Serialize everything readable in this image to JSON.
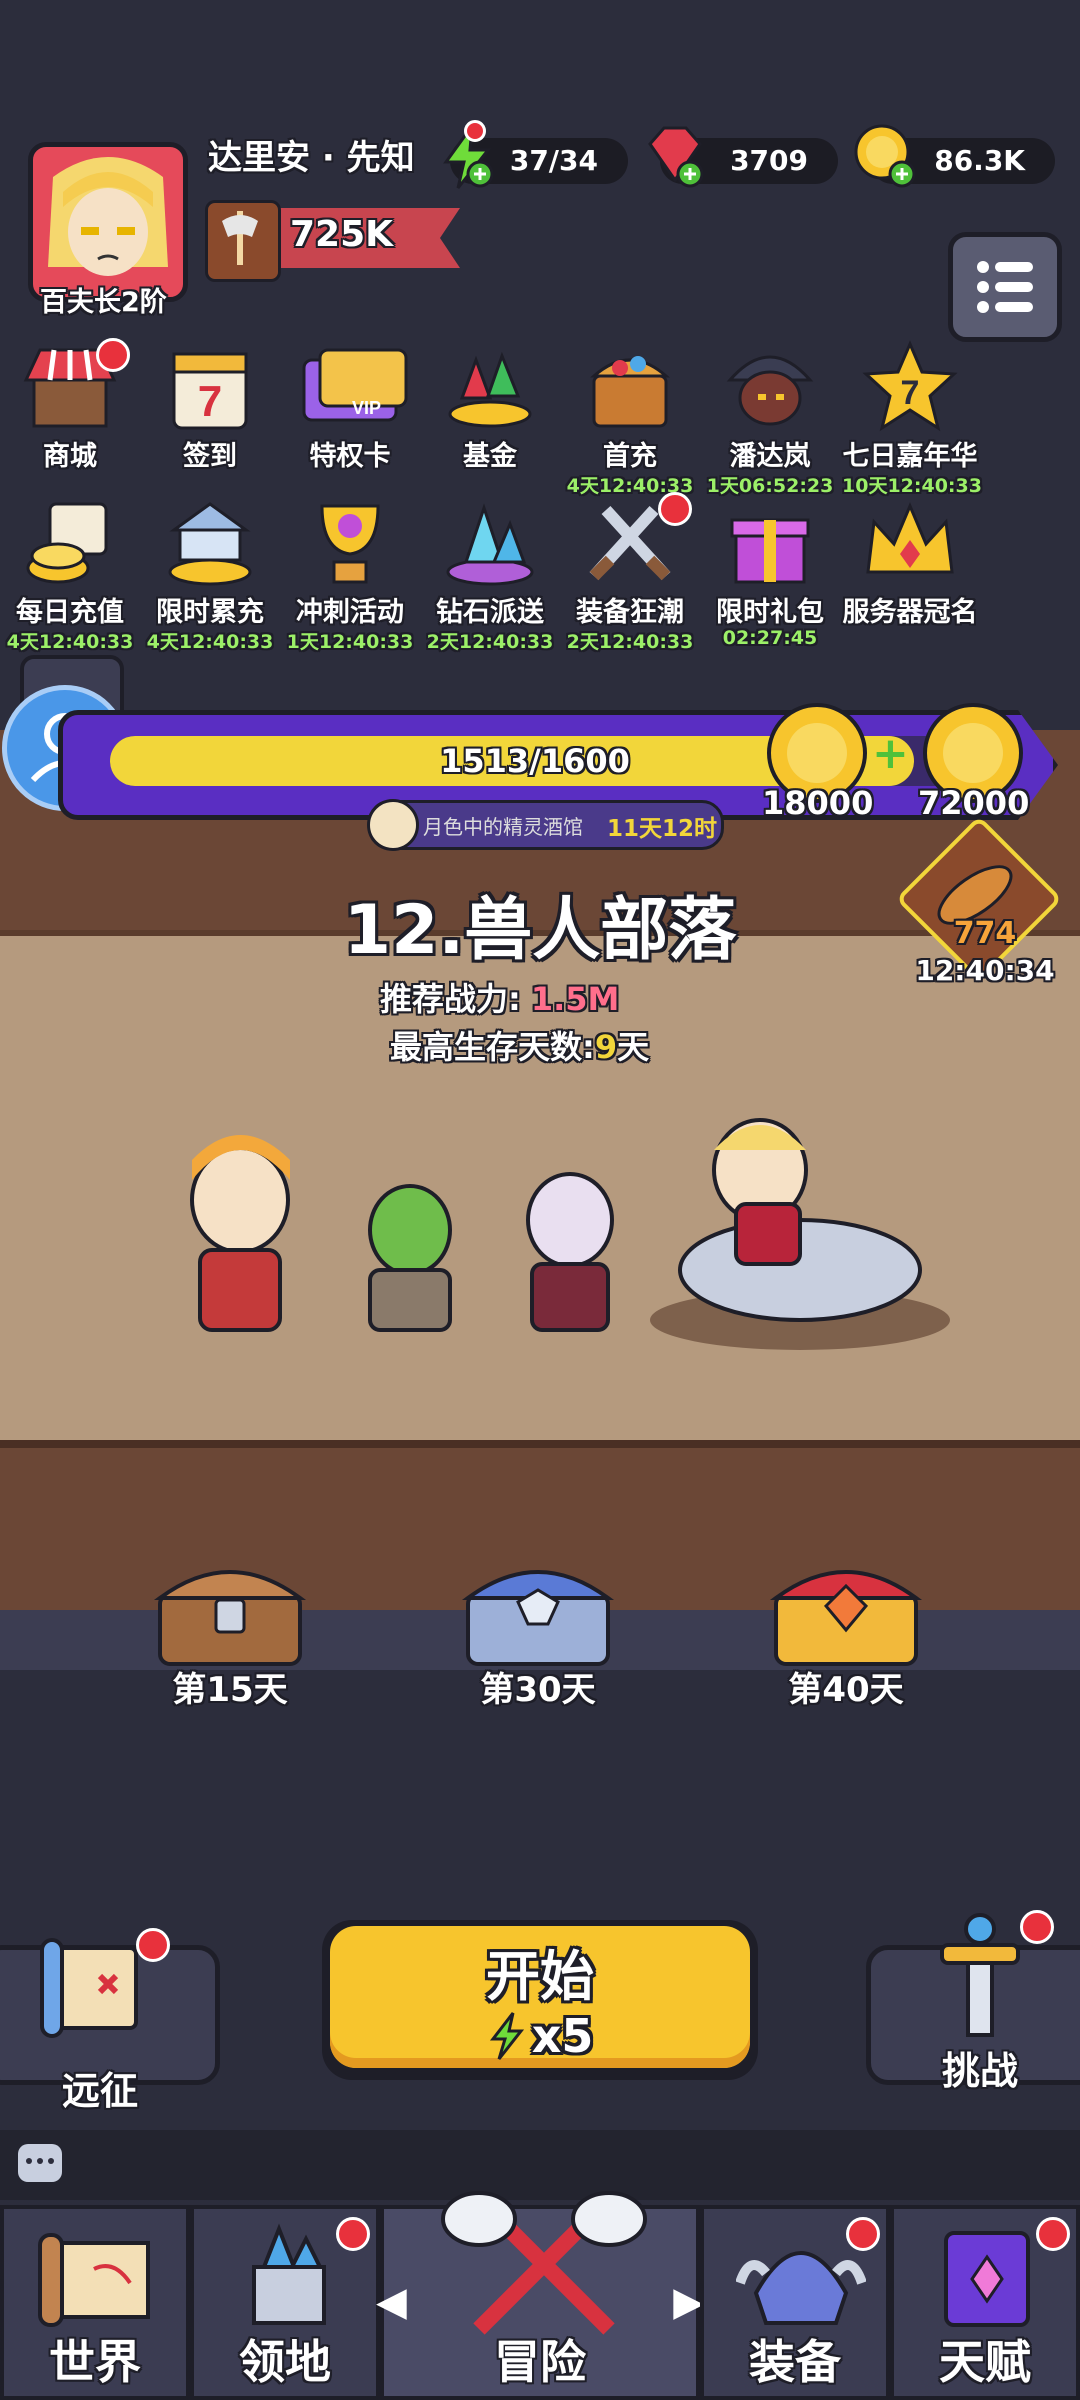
{
  "player": {
    "name": "达里安 · 先知",
    "rank": "百夫长2阶",
    "power": "725K"
  },
  "resources": {
    "energy": "37/34",
    "gems": "3709",
    "gold": "86.3K"
  },
  "events_row1": [
    {
      "label": "商城",
      "time": ""
    },
    {
      "label": "签到",
      "time": ""
    },
    {
      "label": "特权卡",
      "time": ""
    },
    {
      "label": "基金",
      "time": ""
    },
    {
      "label": "首充",
      "time": "4天12:40:33"
    },
    {
      "label": "潘达岚",
      "time": "1天06:52:23"
    },
    {
      "label": "七日嘉年华",
      "time": "10天12:40:33"
    }
  ],
  "events_row2": [
    {
      "label": "每日充值",
      "time": "4天12:40:33"
    },
    {
      "label": "限时累充",
      "time": "4天12:40:33"
    },
    {
      "label": "冲刺活动",
      "time": "1天12:40:33"
    },
    {
      "label": "钻石派送",
      "time": "2天12:40:33"
    },
    {
      "label": "装备狂潮",
      "time": "2天12:40:33"
    },
    {
      "label": "限时礼包",
      "time": "02:27:45"
    },
    {
      "label": "服务器冠名",
      "time": ""
    }
  ],
  "icon_badges": {
    "sign_in": "7",
    "carnival": "7",
    "vip": "VIP"
  },
  "progress": {
    "text": "1513/1600",
    "fraction": 0.946,
    "reward1": "18000",
    "reward2": "72000"
  },
  "tavern": {
    "label": "月色中的精灵酒馆",
    "time": "11天12时"
  },
  "fish": {
    "count": "774",
    "time": "12:40:34"
  },
  "stage": {
    "title": "12.兽人部落",
    "power_label": "推荐战力:",
    "power_value": "1.5M",
    "days_label": "最高生存天数:",
    "days_value": "9",
    "days_unit": "天"
  },
  "chests": [
    {
      "label": "第15天"
    },
    {
      "label": "第30天"
    },
    {
      "label": "第40天"
    }
  ],
  "start": {
    "label": "开始",
    "cost": "x5"
  },
  "side": {
    "left": "远征",
    "right": "挑战"
  },
  "nav": [
    "世界",
    "领地",
    "冒险",
    "装备",
    "天赋"
  ],
  "colors": {
    "accent_yellow": "#f7c52d",
    "badge_red": "#e8313c",
    "timer_green": "#9cf068",
    "power_pink": "#ff6f8c",
    "purple_bar": "#6b3bd6"
  }
}
